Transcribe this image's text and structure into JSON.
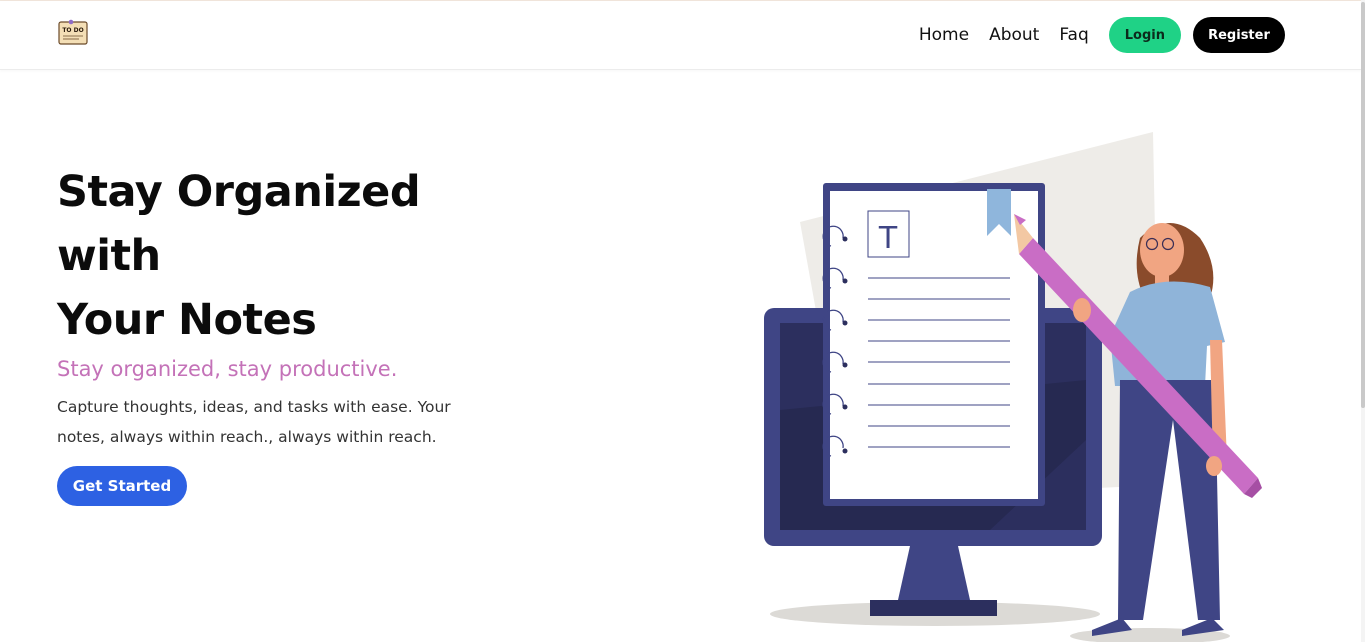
{
  "logo": {
    "text": "TO DO",
    "icon": "todo-note-icon"
  },
  "nav": {
    "links": [
      "Home",
      "About",
      "Faq"
    ],
    "login_label": "Login",
    "register_label": "Register"
  },
  "hero": {
    "title_line1": "Stay Organized with",
    "title_line2": "Your Notes",
    "subtitle": "Stay organized, stay productive.",
    "description": "Capture thoughts, ideas, and tasks with ease. Your notes, always within reach., always within reach.",
    "cta_label": "Get Started"
  },
  "illustration": {
    "note_letter": "T",
    "icon": "notebook-monitor-woman-pencil-illustration"
  },
  "colors": {
    "login_bg": "#1fd286",
    "register_bg": "#000000",
    "cta_bg": "#2d61e3",
    "subtitle": "#c472b8",
    "monitor": "#3f4585",
    "pencil": "#c96dc5"
  }
}
